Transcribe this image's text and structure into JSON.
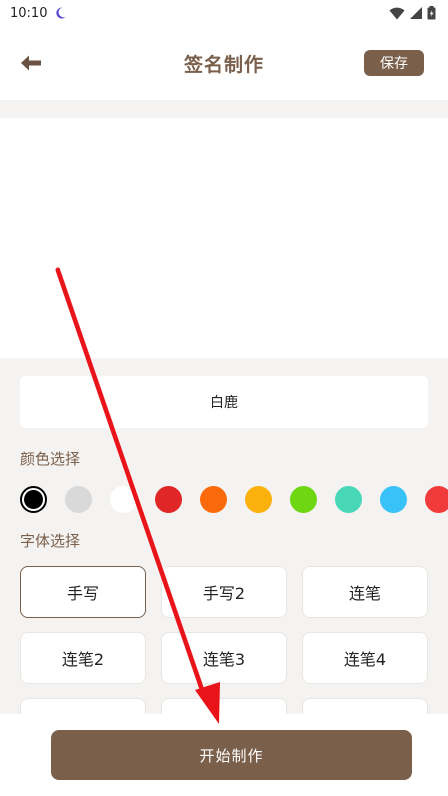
{
  "status_bar": {
    "time": "10:10",
    "icons": [
      "moon-icon",
      "wifi-icon",
      "signal-icon",
      "battery-icon"
    ]
  },
  "header": {
    "back_icon": "arrow-left-icon",
    "title": "签名制作",
    "save_label": "保存"
  },
  "name_input": {
    "value": "白鹿"
  },
  "color_section": {
    "label": "颜色选择",
    "colors": [
      "#000000",
      "#d9d9d9",
      "#ffffff",
      "#e02626",
      "#fb6a0a",
      "#fbb00b",
      "#6ed612",
      "#48d7b6",
      "#38c2f7",
      "#f13b3b"
    ],
    "selected_index": 0
  },
  "font_section": {
    "label": "字体选择",
    "options": [
      "手写",
      "手写2",
      "连笔",
      "连笔2",
      "连笔3",
      "连笔4",
      "",
      "",
      ""
    ],
    "selected_index": 0
  },
  "bottom": {
    "start_label": "开始制作"
  },
  "colors": {
    "accent": "#7a5f4b",
    "panel_bg": "#f4f3f1",
    "annotation_arrow": "#e8141a"
  }
}
